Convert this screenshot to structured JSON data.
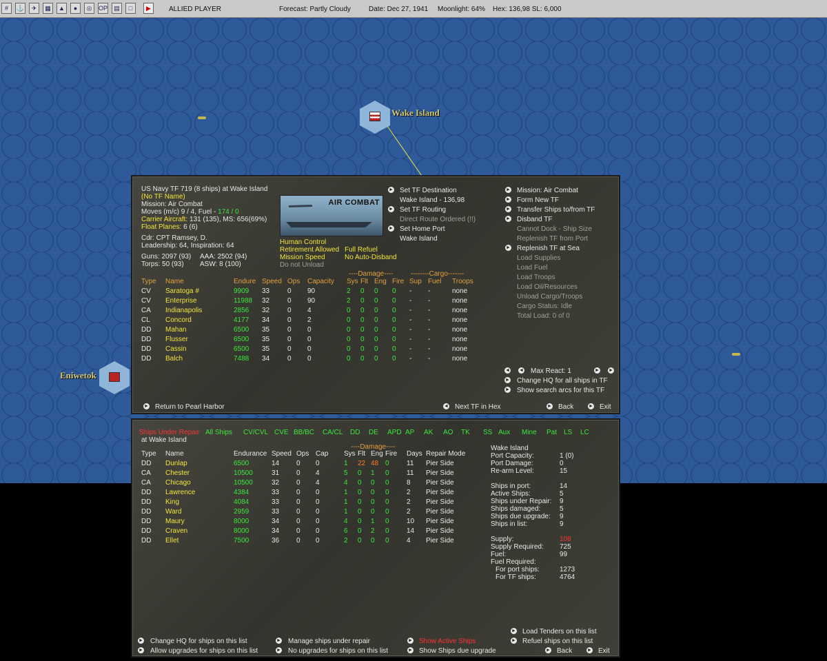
{
  "topbar": {
    "player": "ALLIED PLAYER",
    "forecast": "Forecast: Partly Cloudy",
    "date": "Date: Dec 27, 1941",
    "moonlight": "Moonlight: 64%",
    "hex": "Hex: 136,98  SL: 6,000",
    "buttons": [
      "grid-icon",
      "ship-icon",
      "plane-icon",
      "map-icon",
      "land-icon",
      "globe-icon",
      "target-icon",
      "op-icon",
      "report-icon",
      "window-icon",
      "end-turn-icon"
    ]
  },
  "map": {
    "wake_label": "Wake Island",
    "eniwetok_label": "Eniwetok"
  },
  "tf": {
    "header": {
      "title": "US Navy TF 719 (8 ships) at Wake Island",
      "name": "(No TF Name)",
      "mission": "Mission: Air Combat",
      "moves_a": "Moves (m/c)  9 / 4, Fuel - ",
      "moves_b": "174 / 0",
      "carrier_a": "Carrier Aircraft:",
      "carrier_b": " 131 (135), MS: 656(69%)",
      "float": "Float Planes:",
      "float_b": " 6 (6)",
      "cdr": "Cdr: CPT  Ramsey, D.",
      "leadership": "Leadership: 64, Inspiration: 64",
      "guns": "Guns: 2097 (93)",
      "aaa": "AAA: 2502 (94)",
      "torps": "Torps: 50 (93)",
      "asw": "ASW: 8 (100)"
    },
    "banner_title": "AIR COMBAT",
    "control": {
      "human": "Human Control",
      "retire": "Retirement Allowed",
      "refuel": "Full Refuel",
      "speed": "Mission Speed",
      "disband": "No Auto-Disband",
      "unload": "Do not Unload"
    },
    "dest": {
      "set_dest": "Set TF Destination",
      "dest_val": "Wake Island - 136,98",
      "set_routing": "Set TF Routing",
      "route_val": "Direct Route Ordered (!!)",
      "set_home": "Set Home Port",
      "home_val": "Wake Island"
    },
    "right_menu": [
      {
        "label": "Mission: Air Combat",
        "active": true
      },
      {
        "label": "Form New TF",
        "active": true
      },
      {
        "label": "Transfer Ships to/from TF",
        "active": true
      },
      {
        "label": "Disband TF",
        "active": true
      },
      {
        "label": "Cannot Dock - Ship Size",
        "active": false
      },
      {
        "label": "Replenish TF from Port",
        "active": false
      },
      {
        "label": "Replenish TF at Sea",
        "active": true
      },
      {
        "label": "Load Supplies",
        "active": false
      },
      {
        "label": "Load Fuel",
        "active": false
      },
      {
        "label": "Load Troops",
        "active": false
      },
      {
        "label": "Load Oil/Resources",
        "active": false
      },
      {
        "label": "Unload Cargo/Troops",
        "active": false
      },
      {
        "label": "Cargo Status: Idle",
        "active": false
      },
      {
        "label": "Total Load: 0 of 0",
        "active": false
      }
    ],
    "group_damage": "----Damage----",
    "group_cargo": "--------Cargo-------",
    "columns": [
      "Type",
      "Name",
      "Endure",
      "Speed",
      "Ops",
      "Capacity",
      "Sys",
      "Flt",
      "Eng",
      "Fire",
      "Sup",
      "Fuel",
      "Troops"
    ],
    "ships": [
      {
        "type": "CV",
        "name": "Saratoga #",
        "endure": "9909",
        "speed": "33",
        "ops": "0",
        "cap": "90",
        "sys": "2",
        "flt": "0",
        "eng": "0",
        "fire": "0",
        "sup": "-",
        "fuel": "-",
        "troops": "none"
      },
      {
        "type": "CV",
        "name": "Enterprise",
        "endure": "11988",
        "speed": "32",
        "ops": "0",
        "cap": "90",
        "sys": "2",
        "flt": "0",
        "eng": "0",
        "fire": "0",
        "sup": "-",
        "fuel": "-",
        "troops": "none"
      },
      {
        "type": "CA",
        "name": "Indianapolis",
        "endure": "2856",
        "speed": "32",
        "ops": "0",
        "cap": "4",
        "sys": "0",
        "flt": "0",
        "eng": "0",
        "fire": "0",
        "sup": "-",
        "fuel": "-",
        "troops": "none"
      },
      {
        "type": "CL",
        "name": "Concord",
        "endure": "4177",
        "speed": "34",
        "ops": "0",
        "cap": "2",
        "sys": "0",
        "flt": "0",
        "eng": "0",
        "fire": "0",
        "sup": "-",
        "fuel": "-",
        "troops": "none"
      },
      {
        "type": "DD",
        "name": "Mahan",
        "endure": "6500",
        "speed": "35",
        "ops": "0",
        "cap": "0",
        "sys": "0",
        "flt": "0",
        "eng": "0",
        "fire": "0",
        "sup": "-",
        "fuel": "-",
        "troops": "none"
      },
      {
        "type": "DD",
        "name": "Flusser",
        "endure": "6500",
        "speed": "35",
        "ops": "0",
        "cap": "0",
        "sys": "0",
        "flt": "0",
        "eng": "0",
        "fire": "0",
        "sup": "-",
        "fuel": "-",
        "troops": "none"
      },
      {
        "type": "DD",
        "name": "Cassin",
        "endure": "6500",
        "speed": "35",
        "ops": "0",
        "cap": "0",
        "sys": "0",
        "flt": "0",
        "eng": "0",
        "fire": "0",
        "sup": "-",
        "fuel": "-",
        "troops": "none"
      },
      {
        "type": "DD",
        "name": "Balch",
        "endure": "7488",
        "speed": "34",
        "ops": "0",
        "cap": "0",
        "sys": "0",
        "flt": "0",
        "eng": "0",
        "fire": "0",
        "sup": "-",
        "fuel": "-",
        "troops": "none"
      }
    ],
    "max_react": "Max React:  1",
    "change_hq": "Change HQ for all ships in TF",
    "show_arcs": "Show search arcs for this TF",
    "return": "Return to Pearl Harbor",
    "next_tf": "Next TF in Hex",
    "back": "Back",
    "exit": "Exit"
  },
  "port": {
    "filters": [
      {
        "label": "Ships Under Repair",
        "sel": true
      },
      {
        "label": "All Ships",
        "sel": false
      },
      {
        "label": "CV/CVL",
        "sel": false
      },
      {
        "label": "CVE",
        "sel": false
      },
      {
        "label": "BB/BC",
        "sel": false
      },
      {
        "label": "CA/CL",
        "sel": false
      },
      {
        "label": "DD",
        "sel": false
      },
      {
        "label": "DE",
        "sel": false
      },
      {
        "label": "APD",
        "sel": false
      },
      {
        "label": "AP",
        "sel": false
      },
      {
        "label": "AK",
        "sel": false
      },
      {
        "label": "AO",
        "sel": false
      },
      {
        "label": "TK",
        "sel": false
      },
      {
        "label": "SS",
        "sel": false
      },
      {
        "label": "Aux",
        "sel": false
      },
      {
        "label": "Mine",
        "sel": false
      },
      {
        "label": "Pat",
        "sel": false
      },
      {
        "label": "LS",
        "sel": false
      },
      {
        "label": "LC",
        "sel": false
      }
    ],
    "location": "at Wake Island",
    "group_damage": "----Damage----",
    "columns": [
      "Type",
      "Name",
      "Endurance",
      "Speed",
      "Ops",
      "Cap",
      "Sys",
      "Flt",
      "Eng",
      "Fire",
      "Days",
      "Repair Mode"
    ],
    "ships": [
      {
        "type": "DD",
        "name": "Dunlap",
        "endure": "6500",
        "speed": "14",
        "ops": "0",
        "cap": "0",
        "sys": "1",
        "flt": "22",
        "eng": "48",
        "fire": "0",
        "days": "11",
        "mode": "Pier Side",
        "special": true
      },
      {
        "type": "CA",
        "name": "Chester",
        "endure": "10500",
        "speed": "31",
        "ops": "0",
        "cap": "4",
        "sys": "5",
        "flt": "0",
        "eng": "1",
        "fire": "0",
        "days": "11",
        "mode": "Pier Side",
        "special": false
      },
      {
        "type": "CA",
        "name": "Chicago",
        "endure": "10500",
        "speed": "32",
        "ops": "0",
        "cap": "4",
        "sys": "4",
        "flt": "0",
        "eng": "0",
        "fire": "0",
        "days": "8",
        "mode": "Pier Side",
        "special": false
      },
      {
        "type": "DD",
        "name": "Lawrence",
        "endure": "4384",
        "speed": "33",
        "ops": "0",
        "cap": "0",
        "sys": "1",
        "flt": "0",
        "eng": "0",
        "fire": "0",
        "days": "2",
        "mode": "Pier Side",
        "special": false
      },
      {
        "type": "DD",
        "name": "King",
        "endure": "4084",
        "speed": "33",
        "ops": "0",
        "cap": "0",
        "sys": "1",
        "flt": "0",
        "eng": "0",
        "fire": "0",
        "days": "2",
        "mode": "Pier Side",
        "special": false
      },
      {
        "type": "DD",
        "name": "Ward",
        "endure": "2959",
        "speed": "33",
        "ops": "0",
        "cap": "0",
        "sys": "1",
        "flt": "0",
        "eng": "0",
        "fire": "0",
        "days": "2",
        "mode": "Pier Side",
        "special": false
      },
      {
        "type": "DD",
        "name": "Maury",
        "endure": "8000",
        "speed": "34",
        "ops": "0",
        "cap": "0",
        "sys": "4",
        "flt": "0",
        "eng": "1",
        "fire": "0",
        "days": "10",
        "mode": "Pier Side",
        "special": false
      },
      {
        "type": "DD",
        "name": "Craven",
        "endure": "8000",
        "speed": "34",
        "ops": "0",
        "cap": "0",
        "sys": "6",
        "flt": "0",
        "eng": "2",
        "fire": "0",
        "days": "14",
        "mode": "Pier Side",
        "special": false
      },
      {
        "type": "DD",
        "name": "Ellet",
        "endure": "7500",
        "speed": "36",
        "ops": "0",
        "cap": "0",
        "sys": "2",
        "flt": "0",
        "eng": "0",
        "fire": "0",
        "days": "4",
        "mode": "Pier Side",
        "special": false
      }
    ],
    "info": {
      "title": "Wake Island",
      "rows1": [
        [
          "Port Capacity:",
          "1 (0)"
        ],
        [
          "Port Damage:",
          "0"
        ],
        [
          "Re-arm Level:",
          "15"
        ]
      ],
      "rows2": [
        [
          "Ships in port:",
          "14"
        ],
        [
          "Active Ships:",
          "5"
        ],
        [
          "Ships under Repair:",
          "9"
        ],
        [
          "Ships damaged:",
          "5"
        ],
        [
          "Ships due upgrade:",
          "9"
        ],
        [
          "Ships in list:",
          "9"
        ]
      ],
      "supply_label": "Supply:",
      "supply_val": "108",
      "supply_req_label": "Supply Required:",
      "supply_req_val": "725",
      "fuel_label": "Fuel:",
      "fuel_val": "99",
      "fuel_req_label": "Fuel Required:",
      "port_ships_label": "For port ships:",
      "port_ships_val": "1273",
      "tf_ships_label": "For TF ships:",
      "tf_ships_val": "4764"
    },
    "bottom": {
      "change_hq": "Change HQ for ships on this list",
      "allow_up": "Allow upgrades for ships on this list",
      "manage": "Manage ships under repair",
      "no_up": "No upgrades for ships on this list",
      "show_active": "Show Active Ships",
      "show_due": "Show Ships due upgrade",
      "load_tenders": "Load Tenders on this list",
      "refuel": "Refuel ships on this list",
      "back": "Back",
      "exit": "Exit"
    }
  }
}
